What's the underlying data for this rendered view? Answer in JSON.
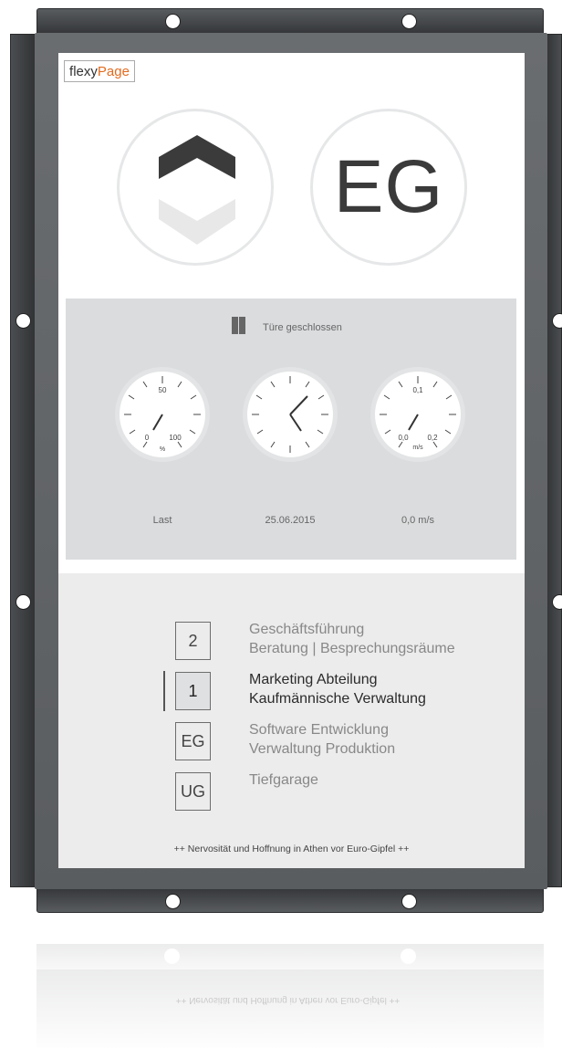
{
  "brand": {
    "logo_part1": "flexy",
    "logo_part2": "Page",
    "accent_color": "#e36b1e"
  },
  "direction": {
    "icon": "chevron-up-down-icon",
    "current": "up"
  },
  "current_floor": "EG",
  "door": {
    "icon": "door-closed-icon",
    "label": "Türe geschlossen"
  },
  "gauges": [
    {
      "name": "load",
      "caption": "Last",
      "labels": [
        "50",
        "0",
        "100",
        "%"
      ],
      "value_percent": 0
    },
    {
      "name": "clock",
      "caption": "25.06.2015"
    },
    {
      "name": "speed",
      "caption": "0,0 m/s",
      "labels": [
        "0,1",
        "0,0",
        "0,2",
        "m/s"
      ],
      "value": 0.0
    }
  ],
  "floors": [
    {
      "id": "2",
      "line1": "Geschäftsführung",
      "line2": "Beratung | Besprechungsräume",
      "active": false
    },
    {
      "id": "1",
      "line1": "Marketing Abteilung",
      "line2": "Kaufmännische Verwaltung",
      "active": true
    },
    {
      "id": "EG",
      "line1": "Software Entwicklung",
      "line2": "Verwaltung Produktion",
      "active": false
    },
    {
      "id": "UG",
      "line1": "Tiefgarage",
      "line2": "",
      "active": false
    }
  ],
  "ticker": "++ Nervosität und Hoffnung in Athen vor Euro-Gipfel ++"
}
